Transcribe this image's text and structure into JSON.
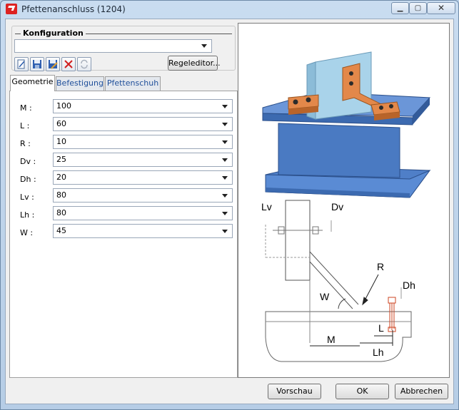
{
  "window": {
    "title": "Pfettenanschluss (1204)"
  },
  "config": {
    "legend": "Konfiguration",
    "selected": "",
    "rule_editor_label": "Regeleditor..."
  },
  "toolbar": {
    "icons": [
      "new-icon",
      "save-icon",
      "save-as-icon",
      "delete-icon",
      "refresh-icon"
    ]
  },
  "tabs": [
    {
      "label": "Geometrie",
      "active": true
    },
    {
      "label": "Befestigung",
      "active": false
    },
    {
      "label": "Pfettenschuh",
      "active": false
    }
  ],
  "geometry": [
    {
      "label": "M :",
      "value": "100"
    },
    {
      "label": "L :",
      "value": "60"
    },
    {
      "label": "R :",
      "value": "10"
    },
    {
      "label": "Dv :",
      "value": "25"
    },
    {
      "label": "Dh :",
      "value": "20"
    },
    {
      "label": "Lv :",
      "value": "80"
    },
    {
      "label": "Lh :",
      "value": "80"
    },
    {
      "label": "W :",
      "value": "45"
    }
  ],
  "drawing_labels": {
    "lv": "Lv",
    "dv": "Dv",
    "r": "R",
    "dh": "Dh",
    "w": "W",
    "l": "L",
    "m": "M",
    "lh": "Lh"
  },
  "buttons": {
    "preview": "Vorschau",
    "ok": "OK",
    "cancel": "Abbrechen"
  },
  "colors": {
    "steel": "#4f7fc8",
    "bracket": "#e3884a",
    "plate": "#a9d3ea",
    "accent": "#d22222"
  }
}
